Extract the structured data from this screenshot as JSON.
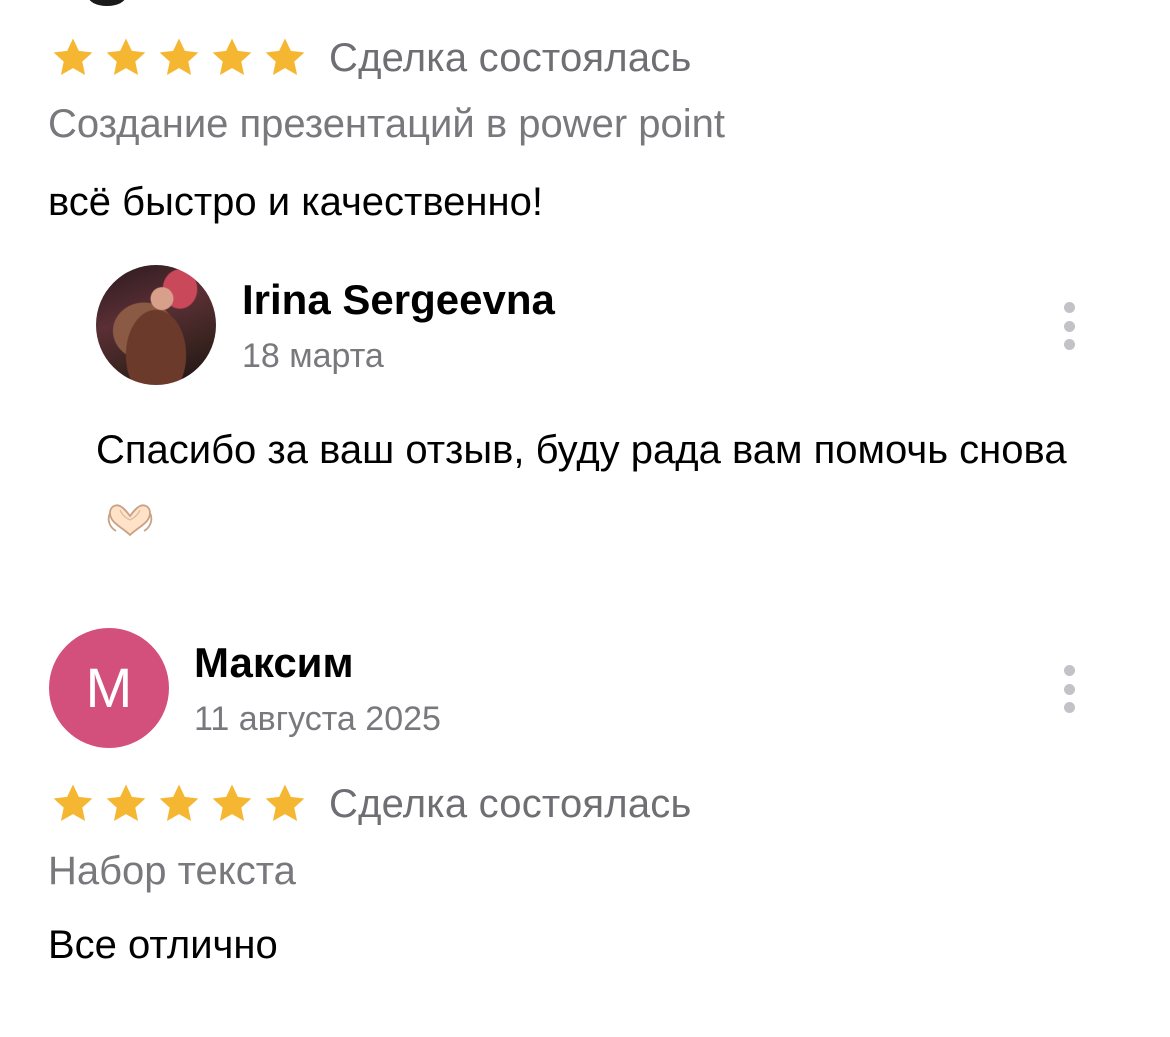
{
  "review1": {
    "rating": 5,
    "rating_max": 5,
    "deal_status": "Сделка состоялась",
    "service": "Создание презентаций в power point",
    "text": "всё быстро и качественно!"
  },
  "reply": {
    "author": "Irina Sergeevna",
    "date": "18 марта",
    "text": "Спасибо за ваш отзыв, буду рада вам помочь снова",
    "emoji_icon": "heart-hands-icon"
  },
  "review2": {
    "avatar_letter": "M",
    "avatar_color": "#d4507c",
    "author": "Максим",
    "date": "11 августа 2025",
    "rating": 5,
    "rating_max": 5,
    "deal_status": "Сделка состоялась",
    "service": "Набор текста",
    "text": "Все отлично"
  },
  "colors": {
    "star": "#f5b731",
    "secondary_text": "#78787d",
    "more_dots": "#c2c2c7"
  }
}
